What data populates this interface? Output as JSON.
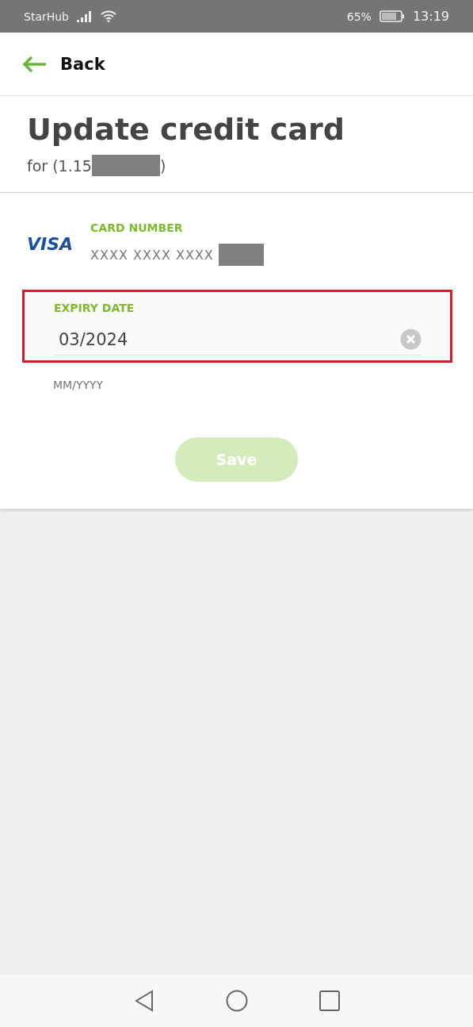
{
  "status_bar": {
    "carrier": "StarHub",
    "battery": "65%",
    "time": "13:19"
  },
  "header": {
    "back_label": "Back"
  },
  "title": "Update credit card",
  "subtitle": {
    "prefix": "for (1.15",
    "suffix": ")",
    "redacted": true
  },
  "card": {
    "brand": "VISA",
    "label": "CARD NUMBER",
    "number": "XXXX XXXX XXXX",
    "redacted": true
  },
  "expiry": {
    "label": "EXPIRY DATE",
    "value": "03/2024",
    "hint": "MM/YYYY",
    "highlighted": true
  },
  "save": {
    "label": "Save",
    "disabled": true
  }
}
